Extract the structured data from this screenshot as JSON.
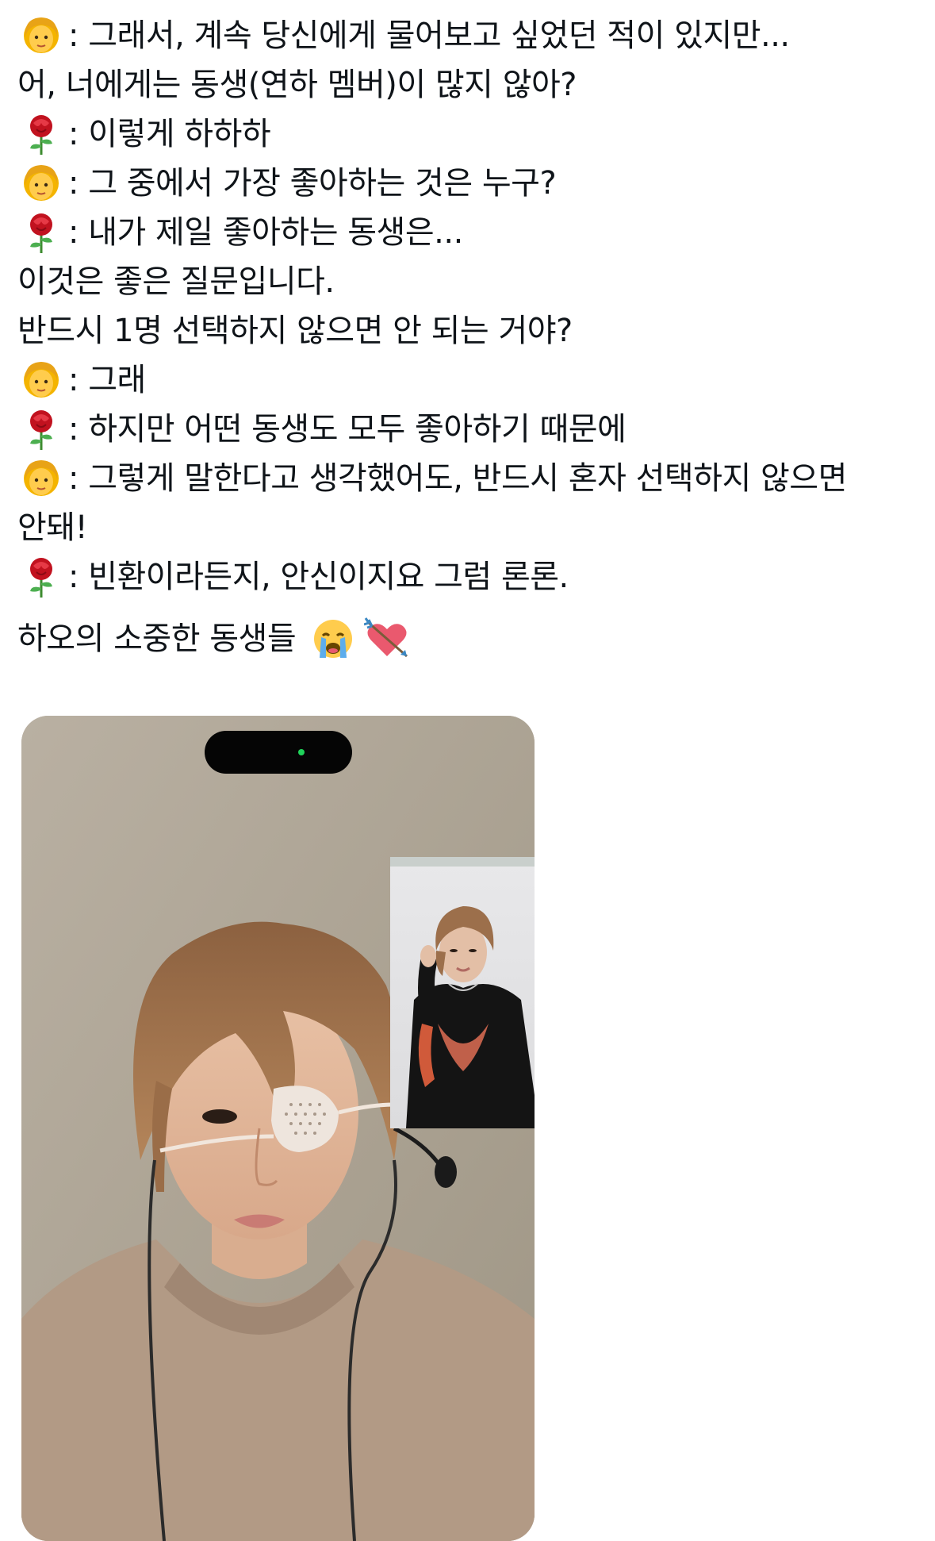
{
  "post": {
    "lines": [
      {
        "speaker": "woman-emoji",
        "text": ": 그래서, 계속 당신에게 물어보고 싶었던 적이 있지만..."
      },
      {
        "speaker": "",
        "text": "어, 너에게는 동생(연하 멤버)이 많지 않아?"
      },
      {
        "speaker": "rose-emoji",
        "text": ": 이렇게 하하하"
      },
      {
        "speaker": "woman-emoji",
        "text": ": 그 중에서 가장 좋아하는 것은 누구?"
      },
      {
        "speaker": "rose-emoji",
        "text": ": 내가 제일 좋아하는 동생은..."
      },
      {
        "speaker": "",
        "text": "이것은 좋은 질문입니다."
      },
      {
        "speaker": "",
        "text": "반드시 1명 선택하지 않으면 안 되는 거야?"
      },
      {
        "speaker": "woman-emoji",
        "text": ": 그래"
      },
      {
        "speaker": "rose-emoji",
        "text": ": 하지만 어떤 동생도 모두 좋아하기 때문에"
      },
      {
        "speaker": "woman-emoji",
        "text": ": 그렇게 말한다고 생각했어도, 반드시 혼자 선택하지 않으면"
      },
      {
        "speaker": "",
        "text": "안돼!"
      },
      {
        "speaker": "rose-emoji",
        "text": ": 빈환이라든지, 안신이지요 그럼 론론."
      }
    ],
    "closing_text": "하오의 소중한 동생들",
    "closing_emojis": [
      "crying-face-emoji",
      "heart-with-arrow-emoji"
    ]
  },
  "media": {
    "description_icon": "video-call-screenshot",
    "accent": "#1fd35a"
  }
}
